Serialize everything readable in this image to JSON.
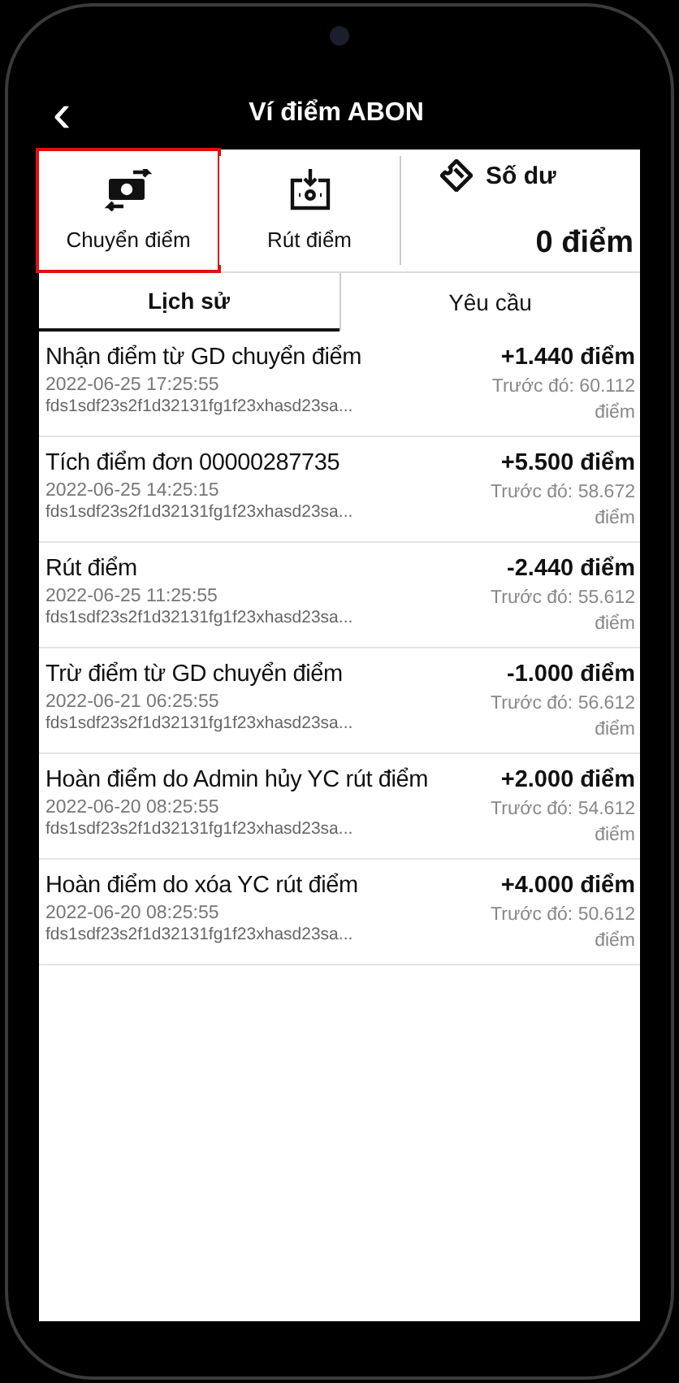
{
  "header": {
    "back": "‹",
    "title": "Ví điểm ABON"
  },
  "actions": [
    {
      "label": "Chuyển điểm",
      "kind": "transfer",
      "highlighted": true
    },
    {
      "label": "Rút điểm",
      "kind": "withdraw",
      "highlighted": false
    }
  ],
  "balance": {
    "label": "Số dư",
    "value": "0 điểm"
  },
  "tabs": [
    {
      "label": "Lịch sử",
      "selected": true
    },
    {
      "label": "Yêu cầu",
      "selected": false
    }
  ],
  "transactions": [
    {
      "title": "Nhận điểm từ GD chuyển điểm",
      "time": "2022-06-25 17:25:55",
      "code": "fds1sdf23s2f1d32131fg1f23xhasd23sa...",
      "amount": "+1.440 điểm",
      "before": "Trước đó: 60.112 điểm"
    },
    {
      "title": "Tích điểm đơn 00000287735",
      "time": "2022-06-25 14:25:15",
      "code": "fds1sdf23s2f1d32131fg1f23xhasd23sa...",
      "amount": "+5.500 điểm",
      "before": "Trước đó: 58.672 điểm"
    },
    {
      "title": "Rút điểm",
      "time": "2022-06-25 11:25:55",
      "code": "fds1sdf23s2f1d32131fg1f23xhasd23sa...",
      "amount": "-2.440 điểm",
      "before": "Trước đó: 55.612 điểm"
    },
    {
      "title": "Trừ điểm từ GD chuyển điểm",
      "time": "2022-06-21 06:25:55",
      "code": "fds1sdf23s2f1d32131fg1f23xhasd23sa...",
      "amount": "-1.000 điểm",
      "before": "Trước đó: 56.612 điểm"
    },
    {
      "title": "Hoàn điểm do Admin hủy YC rút điểm",
      "time": "2022-06-20 08:25:55",
      "code": "fds1sdf23s2f1d32131fg1f23xhasd23sa...",
      "amount": "+2.000 điểm",
      "before": "Trước đó: 54.612 điểm"
    },
    {
      "title": "Hoàn điểm do xóa YC rút điểm",
      "time": "2022-06-20 08:25:55",
      "code": "fds1sdf23s2f1d32131fg1f23xhasd23sa...",
      "amount": "+4.000 điểm",
      "before": "Trước đó: 50.612 điểm"
    }
  ]
}
